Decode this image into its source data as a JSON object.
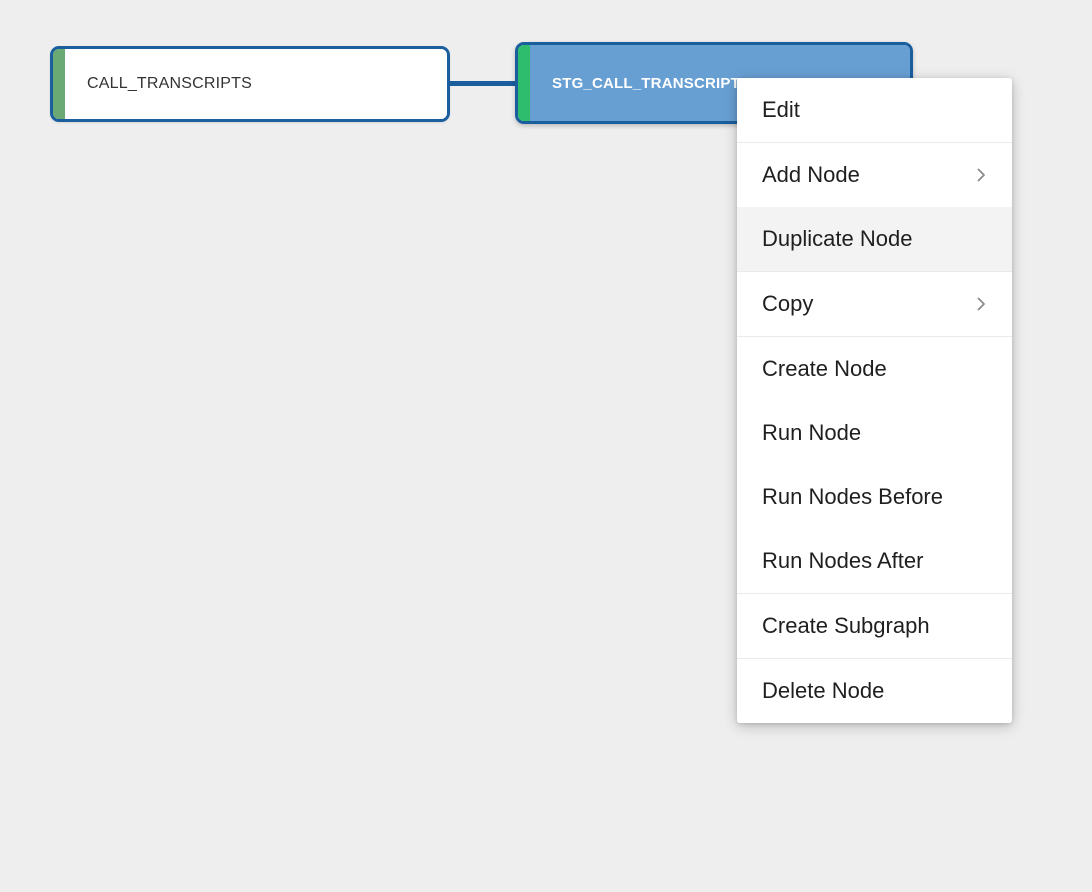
{
  "canvas": {
    "background_color": "#eeeeee"
  },
  "graph": {
    "nodes": [
      {
        "id": "call-transcripts",
        "label": "CALL_TRANSCRIPTS",
        "accent_color": "#6aa874",
        "fill_color": "#ffffff",
        "border_color": "#1b5e9e",
        "selected": false
      },
      {
        "id": "stg-call-transcripts-german",
        "label": "STG_CALL_TRANSCRIPTS_GERMAN",
        "accent_color": "#2ebc6d",
        "fill_color": "#689fd3",
        "border_color": "#1b5e9e",
        "selected": true
      }
    ],
    "edges": [
      {
        "id": "call-to-stg",
        "from": "call-transcripts",
        "to": "stg-call-transcripts-german",
        "color": "#1b5e9e"
      }
    ]
  },
  "context_menu": {
    "highlighted_item": "Duplicate Node",
    "chevron_icon": "chevron-right-icon",
    "groups": [
      {
        "items": [
          {
            "label": "Edit",
            "has_submenu": false,
            "highlighted": false
          }
        ]
      },
      {
        "items": [
          {
            "label": "Add Node",
            "has_submenu": true,
            "highlighted": false
          },
          {
            "label": "Duplicate Node",
            "has_submenu": false,
            "highlighted": true
          }
        ]
      },
      {
        "items": [
          {
            "label": "Copy",
            "has_submenu": true,
            "highlighted": false
          }
        ]
      },
      {
        "items": [
          {
            "label": "Create Node",
            "has_submenu": false,
            "highlighted": false
          },
          {
            "label": "Run Node",
            "has_submenu": false,
            "highlighted": false
          },
          {
            "label": "Run Nodes Before",
            "has_submenu": false,
            "highlighted": false
          },
          {
            "label": "Run Nodes After",
            "has_submenu": false,
            "highlighted": false
          }
        ]
      },
      {
        "items": [
          {
            "label": "Create Subgraph",
            "has_submenu": false,
            "highlighted": false
          }
        ]
      },
      {
        "items": [
          {
            "label": "Delete Node",
            "has_submenu": false,
            "highlighted": false
          }
        ]
      }
    ]
  }
}
